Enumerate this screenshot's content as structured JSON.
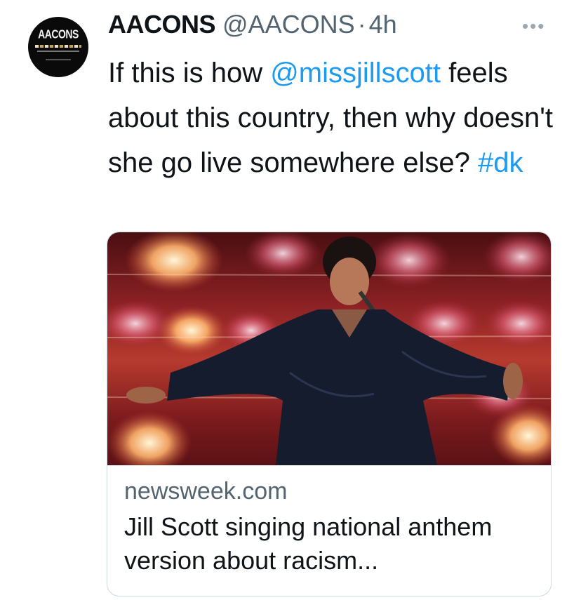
{
  "tweet": {
    "avatar": {
      "logo_text": "AACONS",
      "icon": "aacons-logo"
    },
    "author_name": "AACONS",
    "author_handle": "@AACONS",
    "separator": "·",
    "timestamp": "4h",
    "more_icon": "more-horizontal-icon",
    "text_parts": {
      "line_prefix": "If this is how ",
      "mention": "@missjillscott",
      "middle": " feels about this country, then why doesn't she go live somewhere else? ",
      "hashtag": "#dk"
    }
  },
  "link_card": {
    "image_alt": "Jill Scott singing on stage with arms outstretched",
    "domain": "newsweek.com",
    "title": "Jill Scott singing national anthem version about racism..."
  },
  "colors": {
    "link": "#1d9bf0",
    "text_primary": "#0f1419",
    "text_secondary": "#536471",
    "border": "#cfd9de"
  }
}
